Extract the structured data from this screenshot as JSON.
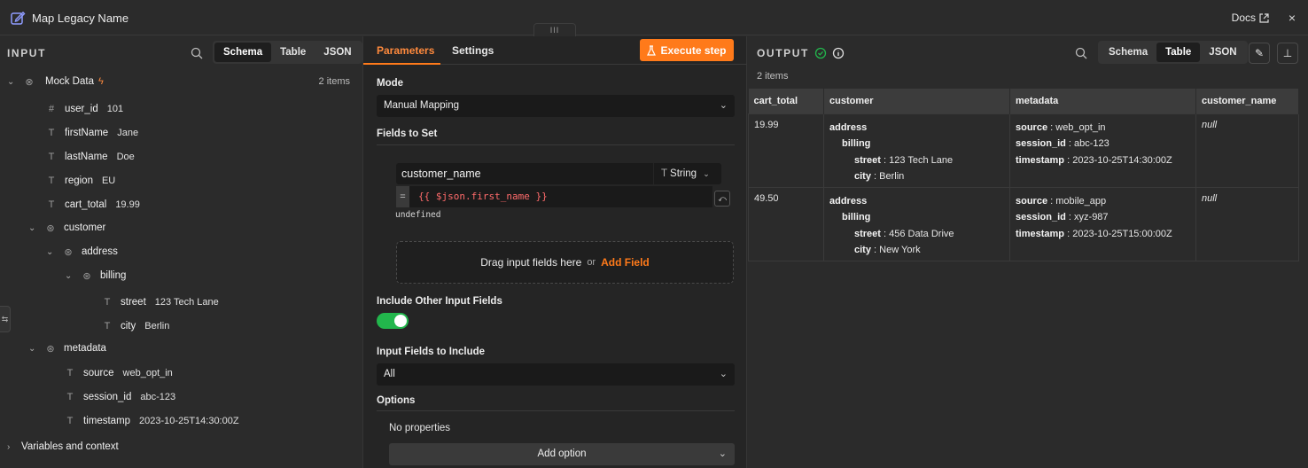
{
  "window": {
    "title": "Map Legacy Name",
    "docs_label": "Docs",
    "close_label": "×",
    "drag_handle": "III"
  },
  "input": {
    "header": "INPUT",
    "views": [
      "Schema",
      "Table",
      "JSON"
    ],
    "active_view": "Schema",
    "root": {
      "label": "Mock Data",
      "count": "2 items"
    },
    "fields": [
      {
        "key": "user_id",
        "value": "101",
        "type": "number"
      },
      {
        "key": "firstName",
        "value": "Jane",
        "type": "string"
      },
      {
        "key": "lastName",
        "value": "Doe",
        "type": "string"
      },
      {
        "key": "region",
        "value": "EU",
        "type": "string"
      },
      {
        "key": "cart_total",
        "value": "19.99",
        "type": "string"
      }
    ],
    "customer": {
      "label": "customer",
      "address": {
        "label": "address",
        "billing": {
          "label": "billing",
          "street": {
            "key": "street",
            "value": "123 Tech Lane"
          },
          "city": {
            "key": "city",
            "value": "Berlin"
          }
        }
      }
    },
    "metadata": {
      "label": "metadata",
      "source": {
        "key": "source",
        "value": "web_opt_in"
      },
      "session_id": {
        "key": "session_id",
        "value": "abc-123"
      },
      "timestamp": {
        "key": "timestamp",
        "value": "2023-10-25T14:30:00Z"
      }
    },
    "footer": "Variables and context"
  },
  "params": {
    "tabs": [
      "Parameters",
      "Settings"
    ],
    "execute_label": "Execute step",
    "mode_label": "Mode",
    "mode_value": "Manual Mapping",
    "fields_to_set_label": "Fields to Set",
    "field_name": "customer_name",
    "field_type": "String",
    "expr_eq": "=",
    "expression": "{{ $json.first_name }}",
    "expression_result": "undefined",
    "drop_text": "Drag input fields here",
    "drop_or": "or",
    "add_field": "Add Field",
    "include_other_label": "Include Other Input Fields",
    "include_other_enabled": true,
    "fields_include_label": "Input Fields to Include",
    "fields_include_value": "All",
    "options_label": "Options",
    "no_properties": "No properties",
    "add_option": "Add option"
  },
  "output": {
    "header": "OUTPUT",
    "count": "2 items",
    "views": [
      "Schema",
      "Table",
      "JSON"
    ],
    "active_view": "Table",
    "columns": [
      "cart_total",
      "customer",
      "metadata",
      "customer_name"
    ],
    "rows": [
      {
        "cart_total": "19.99",
        "address": "address",
        "billing": "billing",
        "street_key": "street",
        "street": "123 Tech Lane",
        "city_key": "city",
        "city": "Berlin",
        "source_key": "source",
        "source": "web_opt_in",
        "session_key": "session_id",
        "session_id": "abc-123",
        "timestamp_key": "timestamp",
        "timestamp": "2023-10-25T14:30:00Z",
        "customer_name": "null"
      },
      {
        "cart_total": "49.50",
        "address": "address",
        "billing": "billing",
        "street_key": "street",
        "street": "456 Data Drive",
        "city_key": "city",
        "city": "New York",
        "source_key": "source",
        "source": "mobile_app",
        "session_key": "session_id",
        "session_id": "xyz-987",
        "timestamp_key": "timestamp",
        "timestamp": "2023-10-25T15:00:00Z",
        "customer_name": "null"
      }
    ]
  },
  "colors": {
    "accent": "#ff7a1a",
    "success": "#22b64c",
    "null_text": "#ff6b6b"
  }
}
